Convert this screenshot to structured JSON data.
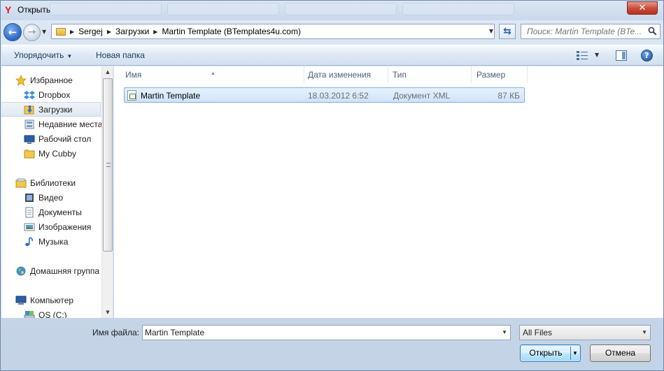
{
  "window": {
    "title": "Открыть",
    "close_label": "✕"
  },
  "address": {
    "crumbs": [
      "Sergej",
      "Загрузки",
      "Martin Template (BTemplates4u.com)"
    ]
  },
  "search": {
    "placeholder": "Поиск: Martin Template (BTe..."
  },
  "toolbar": {
    "organize_label": "Упорядочить",
    "new_folder_label": "Новая папка",
    "help_label": "?"
  },
  "sidebar": {
    "favorites": {
      "label": "Избранное",
      "items": [
        {
          "label": "Dropbox",
          "icon": "dropbox-icon"
        },
        {
          "label": "Загрузки",
          "icon": "downloads-folder-icon",
          "selected": true
        },
        {
          "label": "Недавние места",
          "icon": "recent-places-icon"
        },
        {
          "label": "Рабочий стол",
          "icon": "desktop-icon"
        },
        {
          "label": "My Cubby",
          "icon": "folder-icon"
        }
      ]
    },
    "libraries": {
      "label": "Библиотеки",
      "items": [
        {
          "label": "Видео",
          "icon": "video-icon"
        },
        {
          "label": "Документы",
          "icon": "documents-icon"
        },
        {
          "label": "Изображения",
          "icon": "pictures-icon"
        },
        {
          "label": "Музыка",
          "icon": "music-icon"
        }
      ]
    },
    "homegroup": {
      "label": "Домашняя группа"
    },
    "computer": {
      "label": "Компьютер",
      "items": [
        {
          "label": "OS (C:)",
          "icon": "drive-icon"
        }
      ]
    }
  },
  "filelist": {
    "columns": [
      "Имя",
      "Дата изменения",
      "Тип",
      "Размер"
    ],
    "rows": [
      {
        "name": "Martin Template",
        "date": "18.03.2012 6:52",
        "type": "Документ XML",
        "size": "87 КБ",
        "selected": true
      }
    ]
  },
  "footer": {
    "filename_label": "Имя файла:",
    "filename_value": "Martin Template",
    "filter_value": "All Files",
    "open_label": "Открыть",
    "cancel_label": "Отмена"
  },
  "colors": {
    "selection_bg": "#cfe3fb",
    "selection_border": "#84acdd",
    "link_text": "#1e395b",
    "brand_logo": "#e01b1b"
  }
}
